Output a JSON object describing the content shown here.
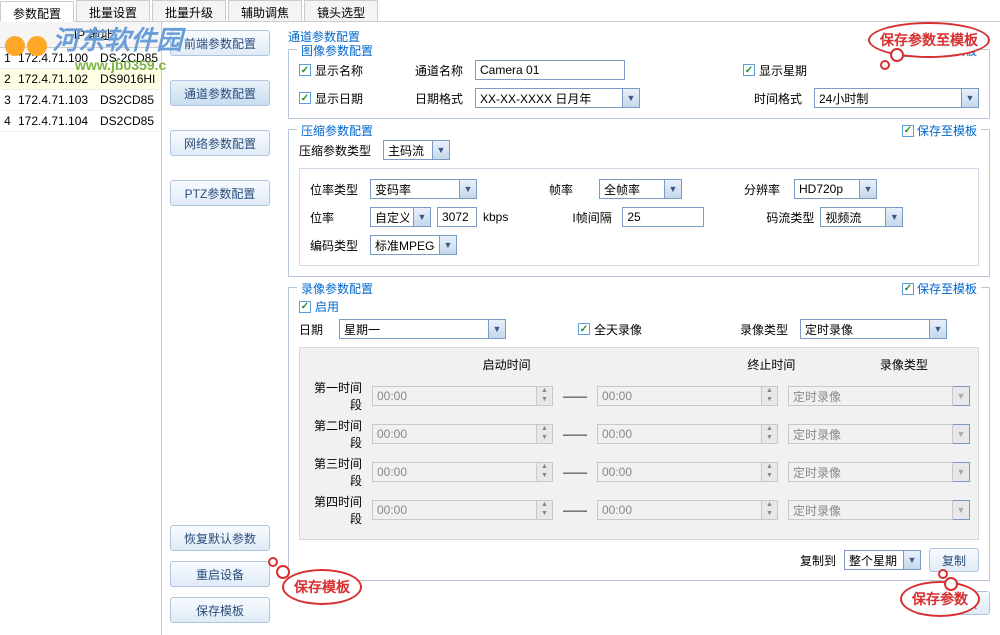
{
  "tabs": [
    "参数配置",
    "批量设置",
    "批量升级",
    "辅助调焦",
    "镜头选型"
  ],
  "active_tab": 0,
  "watermark": {
    "text": "河东软件园",
    "url": "www.jb0359.c"
  },
  "ip_table": {
    "header_num": "",
    "header_ip": "IP 地址",
    "rows": [
      {
        "num": "1",
        "ip": "172.4.71.100",
        "model": "DS-2CD85"
      },
      {
        "num": "2",
        "ip": "172.4.71.102",
        "model": "DS9016HI"
      },
      {
        "num": "3",
        "ip": "172.4.71.103",
        "model": "DS2CD85"
      },
      {
        "num": "4",
        "ip": "172.4.71.104",
        "model": "DS2CD85"
      }
    ],
    "selected_index": 1
  },
  "nav_buttons": [
    "前端参数配置",
    "通道参数配置",
    "网络参数配置",
    "PTZ参数配置"
  ],
  "nav_active": 1,
  "bottom_buttons": [
    "恢复默认参数",
    "重启设备",
    "保存模板"
  ],
  "page_title": "通道参数配置",
  "save_to_template": "保存至模板",
  "image_params": {
    "title": "图像参数配置",
    "show_name": "显示名称",
    "channel_name_label": "通道名称",
    "channel_name_value": "Camera 01",
    "show_week": "显示星期",
    "show_date": "显示日期",
    "date_format_label": "日期格式",
    "date_format_value": "XX-XX-XXXX 日月年",
    "time_format_label": "时间格式",
    "time_format_value": "24小时制"
  },
  "compress_params": {
    "title": "压缩参数配置",
    "type_label": "压缩参数类型",
    "type_value": "主码流",
    "bitrate_type_label": "位率类型",
    "bitrate_type_value": "变码率",
    "fps_label": "帧率",
    "fps_value": "全帧率",
    "resolution_label": "分辨率",
    "resolution_value": "HD720p",
    "bitrate_label": "位率",
    "bitrate_mode": "自定义",
    "bitrate_value": "3072",
    "bitrate_unit": "kbps",
    "iframe_label": "I帧间隔",
    "iframe_value": "25",
    "stream_type_label": "码流类型",
    "stream_type_value": "视频流",
    "encoding_label": "编码类型",
    "encoding_value": "标准MPEG4"
  },
  "record_params": {
    "title": "录像参数配置",
    "enable": "启用",
    "date_label": "日期",
    "date_value": "星期一",
    "allday": "全天录像",
    "record_type_label": "录像类型",
    "record_type_value": "定时录像",
    "grid_headers": [
      "启动时间",
      "终止时间",
      "录像类型"
    ],
    "time_slots": [
      {
        "label": "第一时间段",
        "start": "00:00",
        "end": "00:00",
        "type": "定时录像"
      },
      {
        "label": "第二时间段",
        "start": "00:00",
        "end": "00:00",
        "type": "定时录像"
      },
      {
        "label": "第三时间段",
        "start": "00:00",
        "end": "00:00",
        "type": "定时录像"
      },
      {
        "label": "第四时间段",
        "start": "00:00",
        "end": "00:00",
        "type": "定时录像"
      }
    ],
    "copy_to_label": "复制到",
    "copy_to_value": "整个星期",
    "copy_btn": "复制"
  },
  "save_params_btn": "保存参数",
  "callouts": {
    "top_right": "保存参数至模板",
    "bottom_left": "保存模板",
    "bottom_right": "保存参数"
  }
}
